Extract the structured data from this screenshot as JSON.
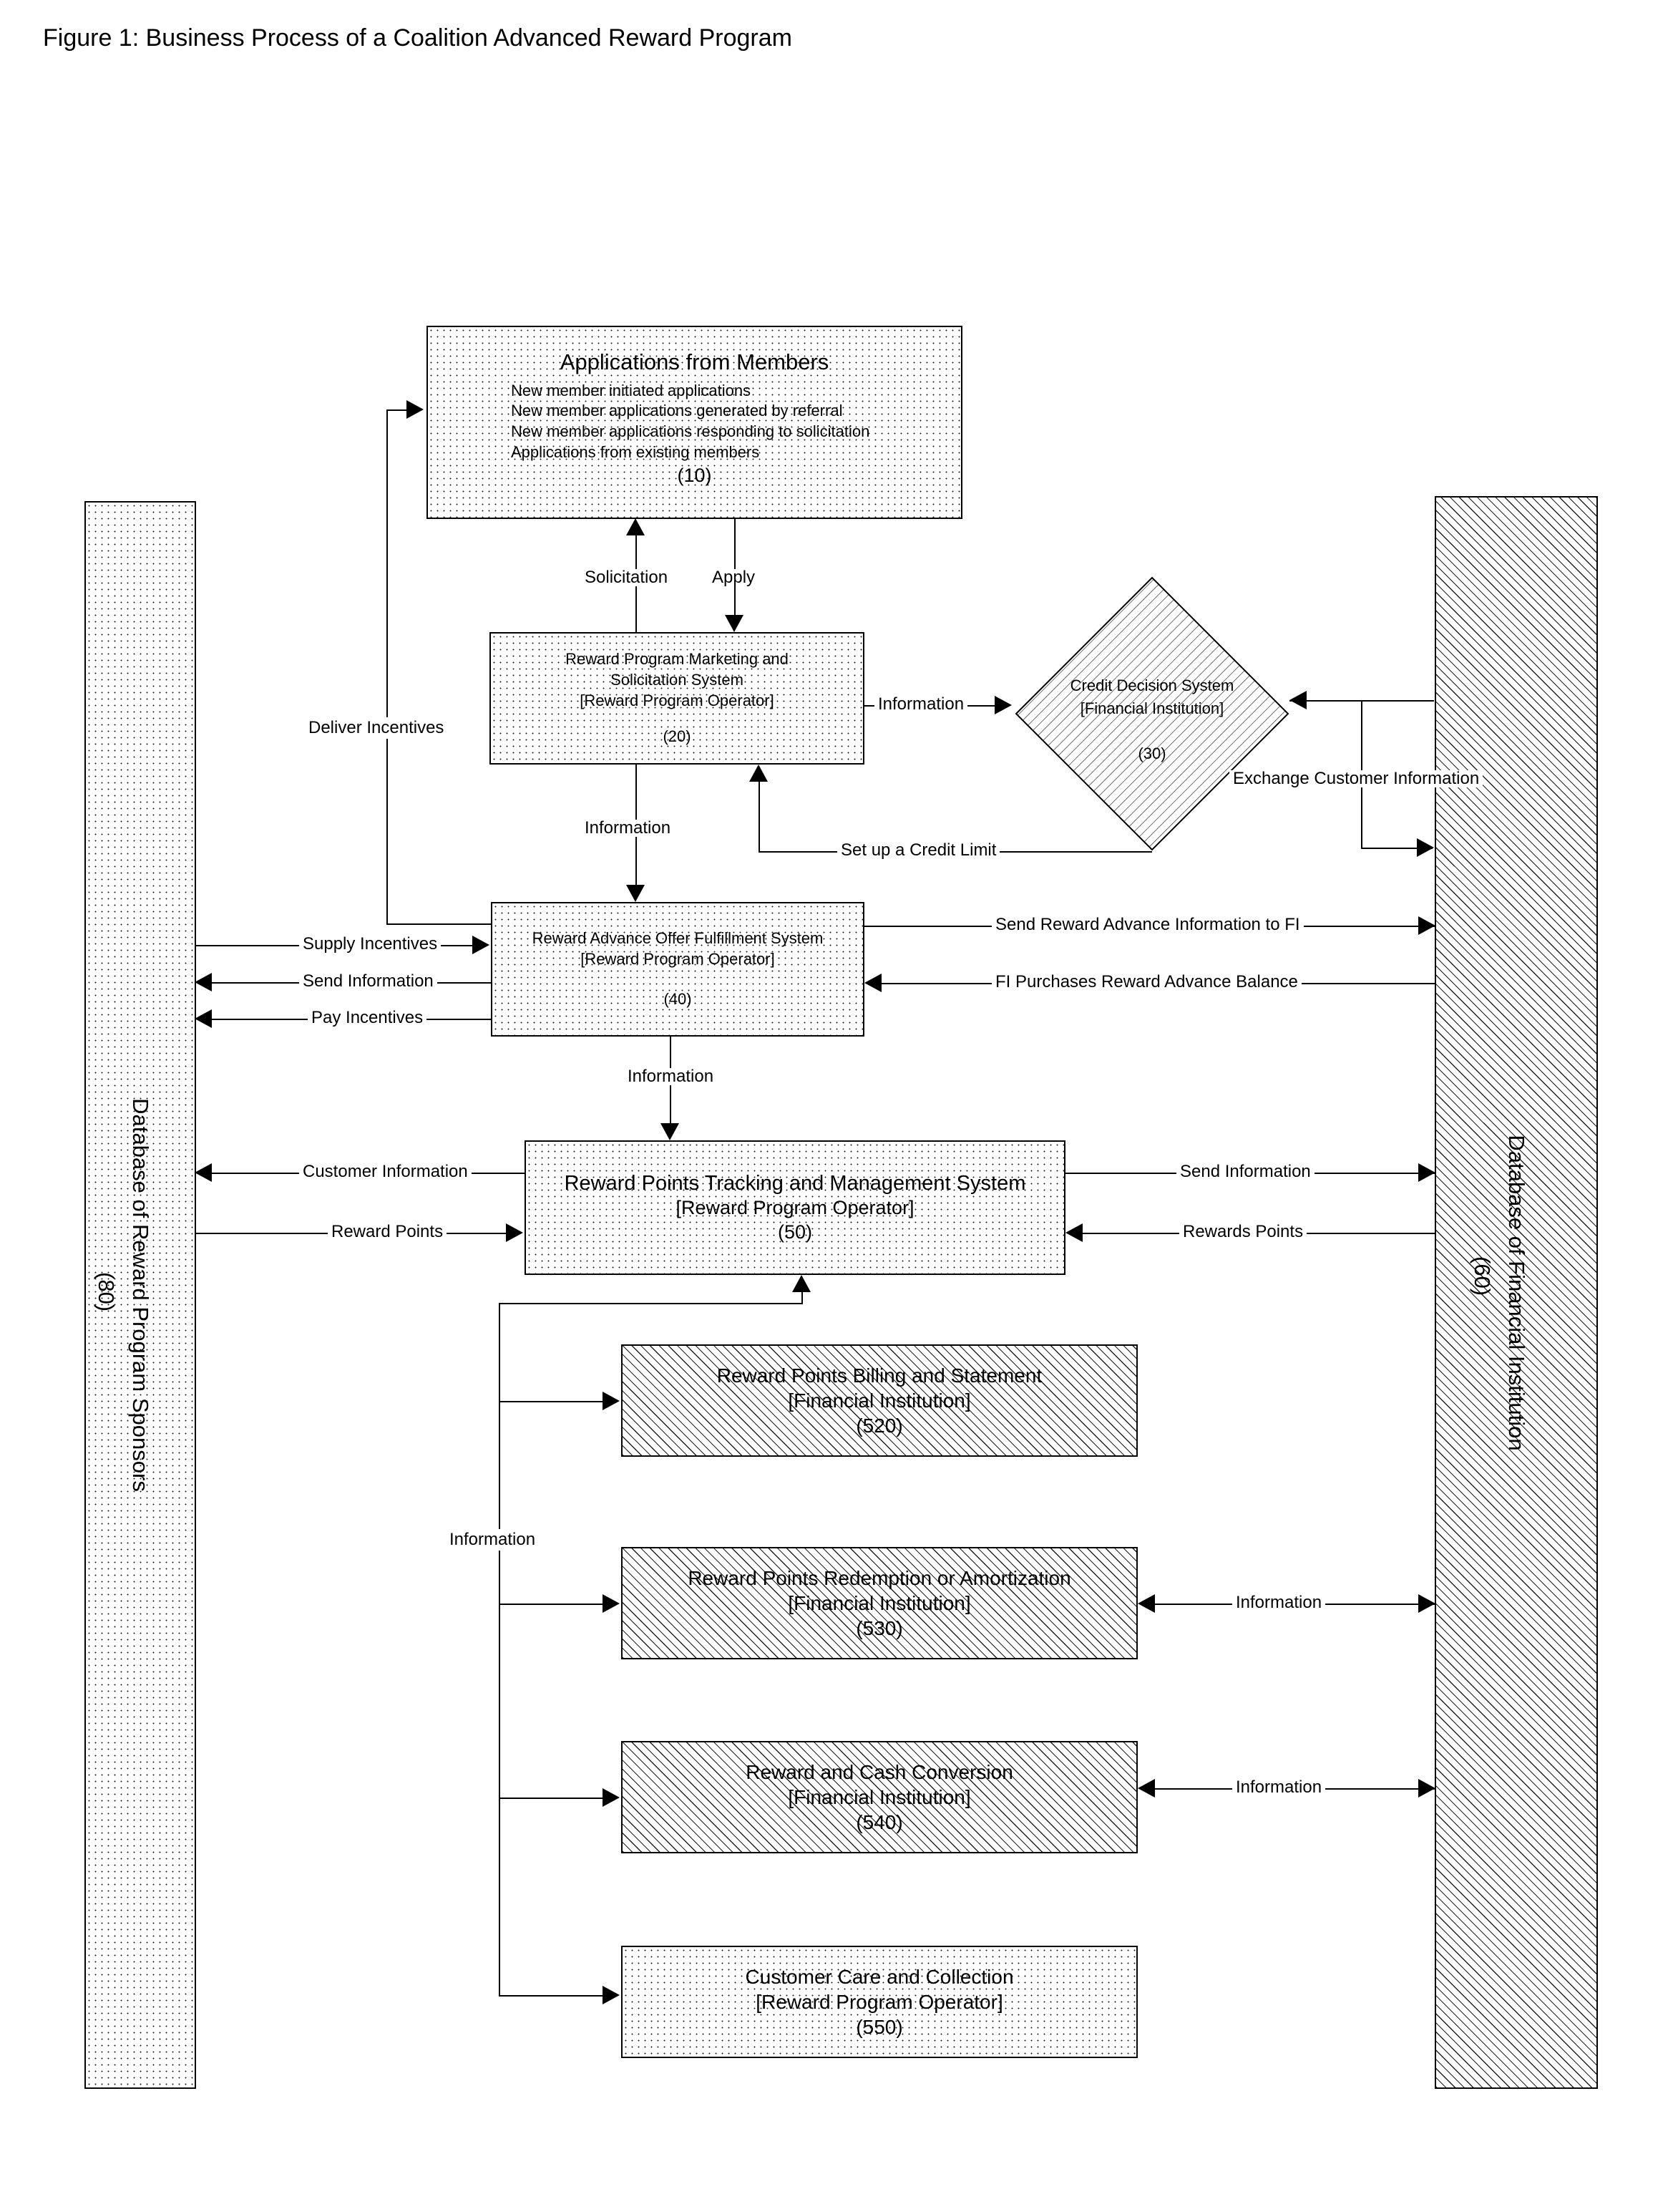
{
  "figure": {
    "title": "Figure 1: Business Process of a Coalition Advanced Reward Program"
  },
  "nodes": {
    "applications": {
      "title": "Applications from Members",
      "bullets": [
        "New member initiated applications",
        "New member applications generated by referral",
        "New member applications responding to  solicitation",
        "Applications from existing members"
      ],
      "ref": "(10)",
      "fill": "dotted"
    },
    "marketing": {
      "title_line1": "Reward Program Marketing and",
      "title_line2": "Solicitation System",
      "owner": "[Reward Program Operator]",
      "ref": "(20)",
      "fill": "dotted"
    },
    "credit_decision": {
      "title": "Credit Decision System",
      "owner": "[Financial Institution]",
      "ref": "(30)",
      "fill": "hatched"
    },
    "advance_offer": {
      "title": "Reward Advance Offer Fulfillment System",
      "owner": "[Reward Program Operator]",
      "ref": "(40)",
      "fill": "dotted"
    },
    "points_tracking": {
      "title": "Reward Points Tracking and Management System",
      "owner": "[Reward Program Operator]",
      "ref": "(50)",
      "fill": "dotted"
    },
    "billing": {
      "title": "Reward Points Billing and Statement",
      "owner": "[Financial Institution]",
      "ref": "(520)",
      "fill": "hatched"
    },
    "redemption": {
      "title": "Reward Points Redemption or Amortization",
      "owner": "[Financial Institution]",
      "ref": "(530)",
      "fill": "hatched"
    },
    "conversion": {
      "title": "Reward and Cash Conversion",
      "owner": "[Financial Institution]",
      "ref": "(540)",
      "fill": "hatched"
    },
    "customer_care": {
      "title": "Customer Care and Collection",
      "owner": "[Reward Program Operator]",
      "ref": "(550)",
      "fill": "dotted"
    }
  },
  "databases": {
    "sponsors": {
      "label": "Database of Reward Program Sponsors",
      "ref": "(80)",
      "fill": "dotted"
    },
    "financial": {
      "label": "Database of Financial Institution",
      "ref": "(60)",
      "fill": "hatched"
    }
  },
  "edges": {
    "solicitation": "Solicitation",
    "apply": "Apply",
    "deliver_incentives": "Deliver Incentives",
    "info_20_to_30": "Information",
    "info_20_to_40": "Information",
    "exchange_customer_information": "Exchange Customer Information",
    "set_up_credit_limit": "Set up a Credit Limit",
    "supply_incentives": "Supply Incentives",
    "send_information_40": "Send Information",
    "pay_incentives": "Pay Incentives",
    "send_reward_advance_information_to_fi": "Send Reward Advance Information to FI",
    "fi_purchases_reward_advance_balance": "FI Purchases Reward Advance Balance",
    "info_40_to_50": "Information",
    "customer_information": "Customer Information",
    "reward_points_left": "Reward Points",
    "send_information_50": "Send Information",
    "rewards_points_right": "Rewards Points",
    "information_bus": "Information",
    "info_530_fi": "Information",
    "info_540_fi": "Information"
  },
  "colors": {
    "stroke": "#000000",
    "background": "#ffffff"
  }
}
